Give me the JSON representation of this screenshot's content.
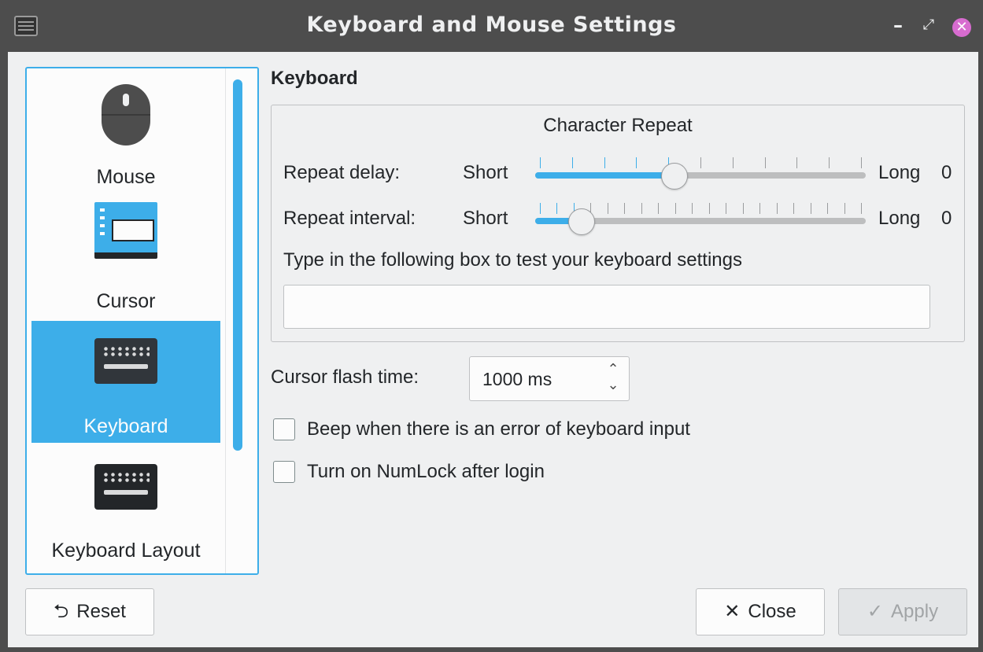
{
  "window": {
    "title": "Keyboard and Mouse Settings",
    "controls": {
      "minimize": "–",
      "maximize": "⤢",
      "close": "✕"
    }
  },
  "sidebar": {
    "items": [
      {
        "label": "Mouse",
        "icon": "mouse-icon",
        "selected": false
      },
      {
        "label": "Cursor",
        "icon": "cursor-theme-icon",
        "selected": false
      },
      {
        "label": "Keyboard",
        "icon": "keyboard-icon",
        "selected": true
      },
      {
        "label": "Keyboard Layout",
        "icon": "keyboard-layout-icon",
        "selected": false
      }
    ]
  },
  "main": {
    "section_title": "Keyboard",
    "character_repeat": {
      "title": "Character Repeat",
      "repeat_delay": {
        "label": "Repeat delay:",
        "min_label": "Short",
        "max_label": "Long",
        "value_text": "0",
        "position": 0.42
      },
      "repeat_interval": {
        "label": "Repeat interval:",
        "min_label": "Short",
        "max_label": "Long",
        "value_text": "0",
        "position": 0.13
      },
      "test_prompt": "Type in the following box to test your keyboard settings",
      "test_value": ""
    },
    "cursor_flash": {
      "label": "Cursor flash time:",
      "value": "1000 ms"
    },
    "checkboxes": [
      {
        "label": "Beep when there is an error of keyboard input",
        "checked": false
      },
      {
        "label": "Turn on NumLock after login",
        "checked": false
      }
    ]
  },
  "footer": {
    "reset": {
      "label": "Reset",
      "icon": "undo-icon"
    },
    "close": {
      "label": "Close",
      "icon": "close-x-icon"
    },
    "apply": {
      "label": "Apply",
      "icon": "checkmark-icon",
      "disabled": true
    }
  },
  "colors": {
    "accent": "#3daee9",
    "titlebar": "#4d4d4d",
    "window_bg": "#eff0f1",
    "close_button": "#d76ccf"
  }
}
